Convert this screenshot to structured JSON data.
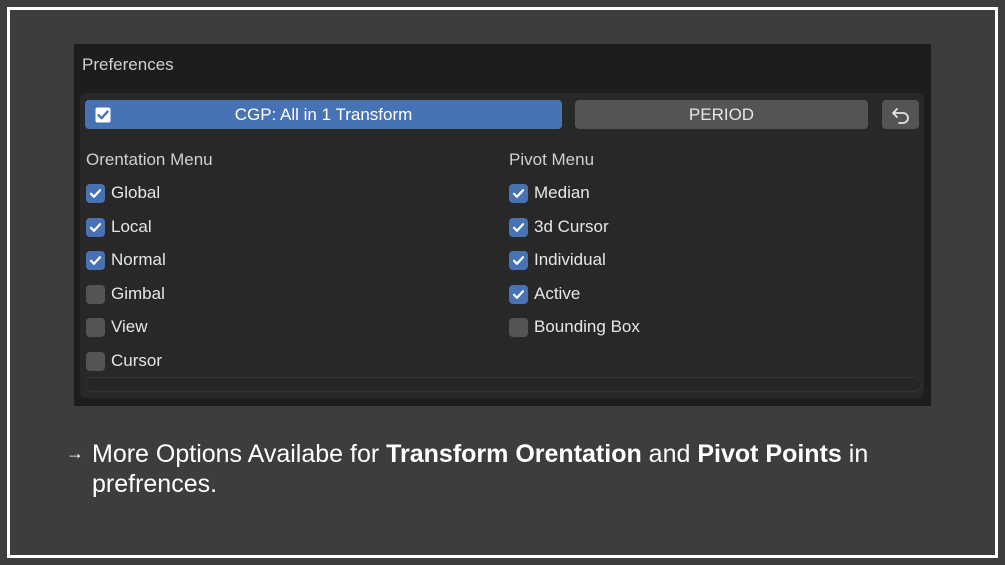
{
  "panel": {
    "title": "Preferences",
    "addon_name": "CGP: All in 1 Transform",
    "addon_enabled": true,
    "period_label": "PERIOD",
    "reset_icon": "undo-icon"
  },
  "orientation_menu": {
    "title": "Orentation Menu",
    "options": [
      {
        "label": "Global",
        "checked": true
      },
      {
        "label": "Local",
        "checked": true
      },
      {
        "label": "Normal",
        "checked": true
      },
      {
        "label": "Gimbal",
        "checked": false
      },
      {
        "label": "View",
        "checked": false
      },
      {
        "label": "Cursor",
        "checked": false
      }
    ]
  },
  "pivot_menu": {
    "title": "Pivot Menu",
    "options": [
      {
        "label": "Median",
        "checked": true
      },
      {
        "label": "3d Cursor",
        "checked": true
      },
      {
        "label": "Individual",
        "checked": true
      },
      {
        "label": "Active",
        "checked": true
      },
      {
        "label": "Bounding Box",
        "checked": false
      }
    ]
  },
  "note": {
    "bullet": "→",
    "part1": "More Options Availabe for ",
    "bold1": "Transform Orentation",
    "part2": " and ",
    "bold2": "Pivot Points",
    "part3": " in",
    "line2": "prefrences."
  },
  "colors": {
    "accent": "#4772b3",
    "background": "#3d3d3d",
    "panel": "#1d1d1d"
  }
}
